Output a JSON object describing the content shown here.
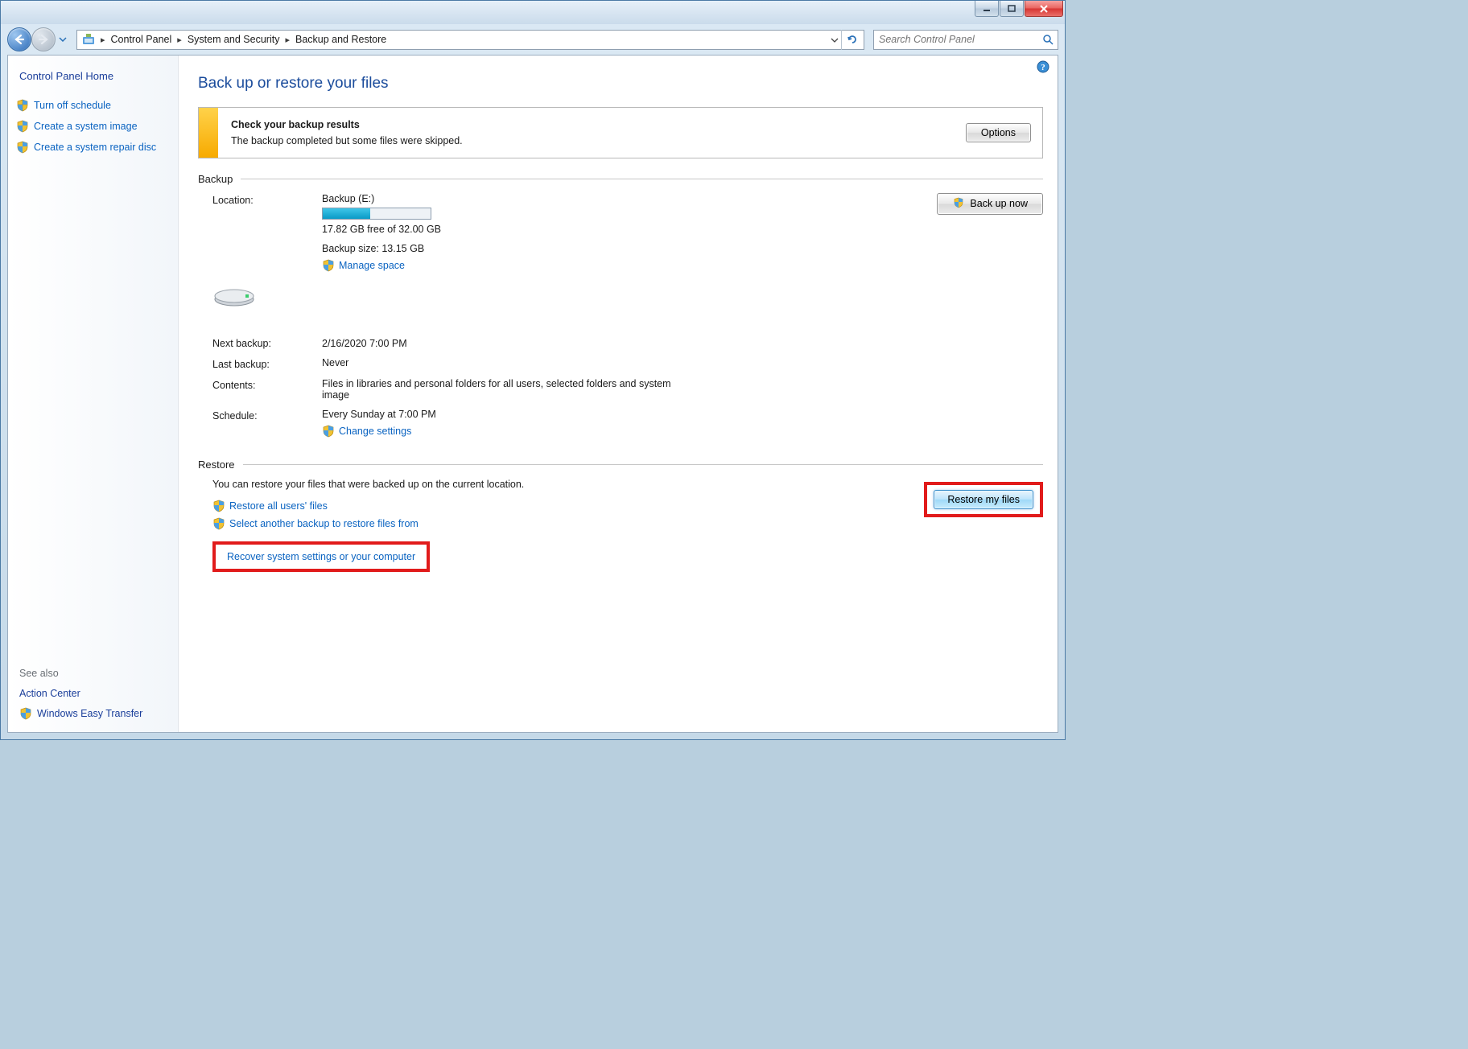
{
  "breadcrumb": {
    "item0": "Control Panel",
    "item1": "System and Security",
    "item2": "Backup and Restore"
  },
  "search": {
    "placeholder": "Search Control Panel"
  },
  "sidebar": {
    "home": "Control Panel Home",
    "link0": "Turn off schedule",
    "link1": "Create a system image",
    "link2": "Create a system repair disc",
    "see_also": "See also",
    "bottom0": "Action Center",
    "bottom1": "Windows Easy Transfer"
  },
  "main": {
    "title": "Back up or restore your files",
    "notice": {
      "title": "Check your backup results",
      "body": "The backup completed but some files were skipped.",
      "options_btn": "Options"
    },
    "backup": {
      "header": "Backup",
      "location_label": "Location:",
      "location_value": "Backup (E:)",
      "free_text": "17.82 GB free of 32.00 GB",
      "size_text": "Backup size: 13.15 GB",
      "manage_space": "Manage space",
      "backup_now_btn": "Back up now",
      "next_label": "Next backup:",
      "next_value": "2/16/2020 7:00 PM",
      "last_label": "Last backup:",
      "last_value": "Never",
      "contents_label": "Contents:",
      "contents_value": "Files in libraries and personal folders for all users, selected folders and system image",
      "schedule_label": "Schedule:",
      "schedule_value": "Every Sunday at 7:00 PM",
      "change_settings": "Change settings",
      "progress_pct": 44
    },
    "restore": {
      "header": "Restore",
      "desc": "You can restore your files that were backed up on the current location.",
      "restore_all": "Restore all users' files",
      "select_another": "Select another backup to restore files from",
      "recover": "Recover system settings or your computer",
      "restore_btn": "Restore my files"
    }
  }
}
